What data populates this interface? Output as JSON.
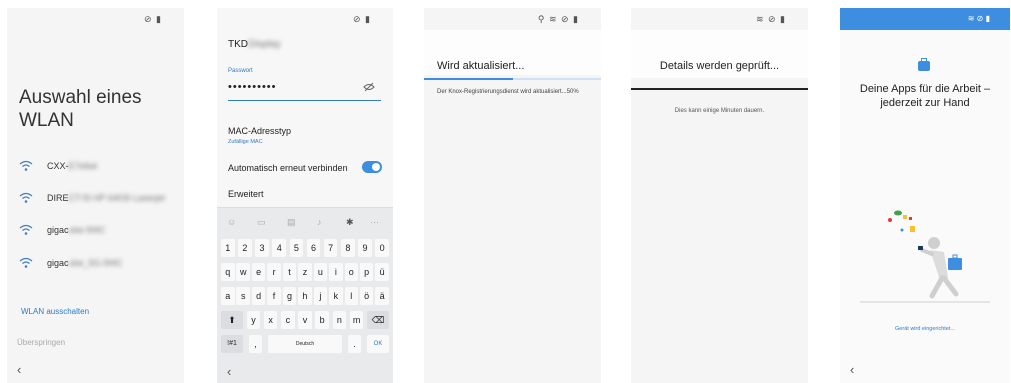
{
  "screen1": {
    "title": "Auswahl eines WLAN",
    "networks": [
      {
        "visible": "CXX-",
        "blurred": "E7eliwl"
      },
      {
        "visible": "DIRE",
        "blurred": "CT-f3 HP 6403I Laserjet"
      },
      {
        "visible": "gigac",
        "blurred": "ube-5f4C"
      },
      {
        "visible": "gigac",
        "blurred": "ube_5G-5f4C"
      }
    ],
    "wlan_off": "WLAN ausschalten",
    "skip": "Überspringen"
  },
  "screen2": {
    "ssid": "TKD",
    "ssid_blurred": "Display",
    "password_label": "Passwort",
    "password_value": "••••••••••",
    "mac_type": "MAC-Adresstyp",
    "mac_sub": "Zufällige MAC",
    "reconnect": "Automatisch erneut verbinden",
    "advanced": "Erweitert",
    "keyboard": {
      "row1": [
        "1",
        "2",
        "3",
        "4",
        "5",
        "6",
        "7",
        "8",
        "9",
        "0"
      ],
      "row2": [
        "q",
        "w",
        "e",
        "r",
        "t",
        "z",
        "u",
        "i",
        "o",
        "p",
        "ü"
      ],
      "row3": [
        "a",
        "s",
        "d",
        "f",
        "g",
        "h",
        "j",
        "k",
        "l",
        "ö",
        "ä"
      ],
      "row4": [
        "y",
        "x",
        "c",
        "v",
        "b",
        "n",
        "m"
      ],
      "symbols": "!#1",
      "comma": ",",
      "space": "Deutsch",
      "period": ".",
      "ok": "OK",
      "shift": "⬆",
      "backspace": "⌫"
    }
  },
  "screen3": {
    "title": "Wird aktualisiert...",
    "body": "Der Knox-Registrierungsdienst wird aktualisiert...50%",
    "progress": 0.5
  },
  "screen4": {
    "title": "Details werden geprüft...",
    "body": "Dies kann einige Minuten dauern."
  },
  "screen5": {
    "title": "Deine Apps für die Arbeit – jederzeit zur Hand",
    "status": "Gerät wird eingerichtet..."
  },
  "colors": {
    "accent": "#3d8ee0",
    "link": "#2e7bc4"
  }
}
